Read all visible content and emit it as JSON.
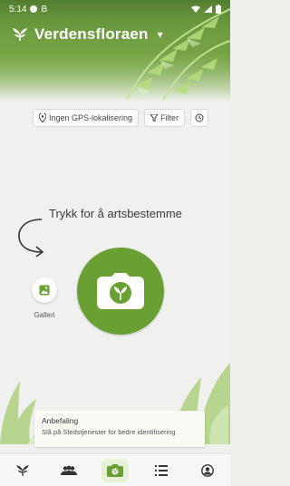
{
  "status_bar": {
    "time": "5:14",
    "b_letter": "B"
  },
  "header": {
    "app_title": "Verdensfloraen",
    "dropdown_indicator": "▾"
  },
  "chips": [
    {
      "label": "Ingen GPS-lokalisering",
      "icon": "location-pin-icon"
    },
    {
      "label": "Filter",
      "icon": "filter-icon"
    },
    {
      "label": "",
      "icon": "clock-icon"
    }
  ],
  "main": {
    "hint_text": "Trykk for å artsbestemme"
  },
  "gallery": {
    "label": "Galleri"
  },
  "recommendation": {
    "title": "Anbefaling",
    "text": "Slå på Stedstjenester for bedre identifisering"
  },
  "nav": [
    {
      "name": "nav-plants",
      "icon": "leaf-icon"
    },
    {
      "name": "nav-community",
      "icon": "people-icon"
    },
    {
      "name": "nav-camera",
      "icon": "camera-icon",
      "active": true
    },
    {
      "name": "nav-list",
      "icon": "list-icon"
    },
    {
      "name": "nav-profile",
      "icon": "profile-icon"
    }
  ],
  "colors": {
    "brand_green": "#6a9f33",
    "active_bg": "#e6f1d6"
  }
}
